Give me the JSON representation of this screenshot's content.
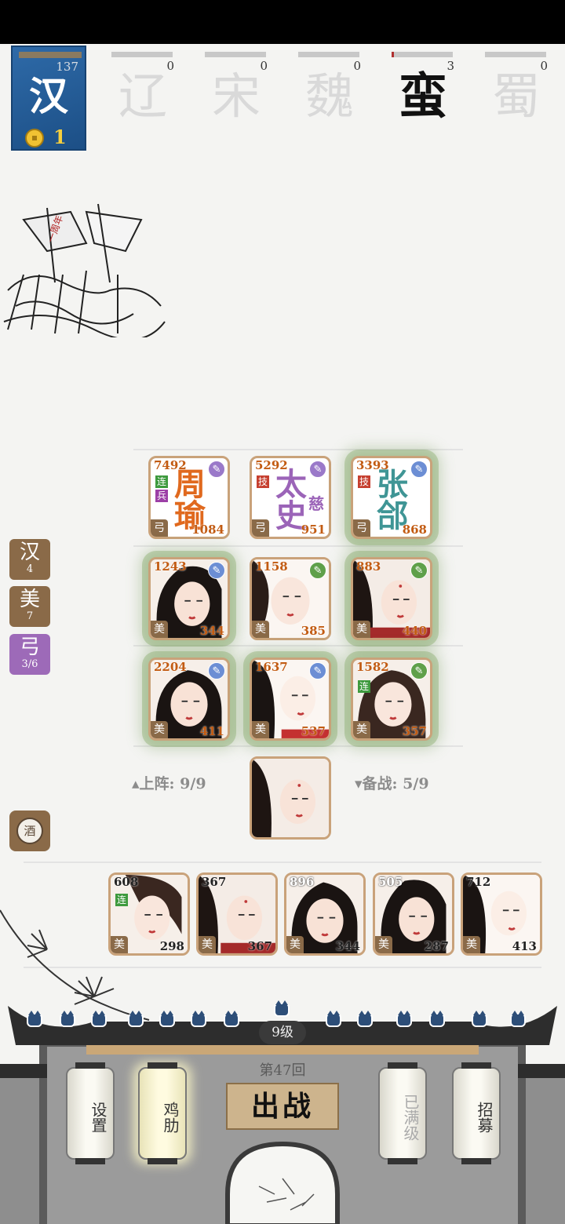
{
  "factions": [
    {
      "name": "汉",
      "count": "137",
      "progress": 1.0,
      "coins": "1"
    },
    {
      "name": "辽",
      "count": "0",
      "progress": 0
    },
    {
      "name": "宋",
      "count": "0",
      "progress": 0
    },
    {
      "name": "魏",
      "count": "0",
      "progress": 0
    },
    {
      "name": "蛮",
      "count": "3",
      "progress": 0.04
    },
    {
      "name": "蜀",
      "count": "0",
      "progress": 0
    }
  ],
  "deployed": [
    {
      "kind": "name",
      "name_top": "周",
      "name_bottom": "瑜",
      "top": "7492",
      "bottom": "1084",
      "tags": [
        "连",
        "兵"
      ],
      "type": "弓",
      "skill_color": "#9a79c9",
      "name_color": "#e0691e"
    },
    {
      "kind": "name",
      "name_top": "太",
      "name_bottom": "史",
      "name_extra": "慈",
      "top": "5292",
      "bottom": "951",
      "tags": [
        "技"
      ],
      "type": "弓",
      "skill_color": "#9a79c9",
      "name_color": "#9b64b8"
    },
    {
      "kind": "name",
      "name_top": "张",
      "name_bottom": "郃",
      "top": "3393",
      "bottom": "868",
      "tags": [
        "技"
      ],
      "type": "弓",
      "skill_color": "#6c8ed4",
      "name_color": "#3f9595"
    },
    {
      "kind": "portrait",
      "top": "1243",
      "bottom": "344",
      "type": "美",
      "skill_color": "#6c8ed4"
    },
    {
      "kind": "portrait",
      "top": "1158",
      "bottom": "385",
      "type": "美",
      "skill_color": "#5fa04a"
    },
    {
      "kind": "portrait",
      "top": "883",
      "bottom": "440",
      "type": "美",
      "skill_color": "#5fa04a"
    },
    {
      "kind": "portrait",
      "top": "2204",
      "bottom": "411",
      "type": "美",
      "skill_color": "#6c8ed4"
    },
    {
      "kind": "portrait",
      "top": "1637",
      "bottom": "537",
      "type": "美",
      "skill_color": "#6c8ed4"
    },
    {
      "kind": "portrait",
      "top": "1582",
      "bottom": "357",
      "type": "美",
      "skill_color": "#5fa04a",
      "tags": [
        "连"
      ]
    }
  ],
  "side_tags": [
    {
      "label": "汉",
      "count": "4"
    },
    {
      "label": "美",
      "count": "7"
    },
    {
      "label": "弓",
      "count": "3/6"
    }
  ],
  "on_field": "▴上阵: 9/9",
  "reserve_status": "▾备战: 5/9",
  "wine_label": "酒",
  "bench": [
    {
      "top": "608",
      "bottom": "298",
      "type": "美",
      "tags": [
        "连"
      ]
    },
    {
      "top": "367",
      "bottom": "367",
      "type": "美"
    },
    {
      "top": "896",
      "bottom": "344",
      "type": "美"
    },
    {
      "top": "505",
      "bottom": "287",
      "type": "美"
    },
    {
      "top": "712",
      "bottom": "413",
      "type": "美"
    }
  ],
  "level": "9级",
  "round": "第47回",
  "battle_label": "出战",
  "lanterns": [
    {
      "label": "设置",
      "state": "normal"
    },
    {
      "label": "鸡肋",
      "state": "lit"
    },
    {
      "label": "已满级",
      "state": "dim"
    },
    {
      "label": "招募",
      "state": "normal"
    }
  ],
  "sketch_flag": "一周年"
}
